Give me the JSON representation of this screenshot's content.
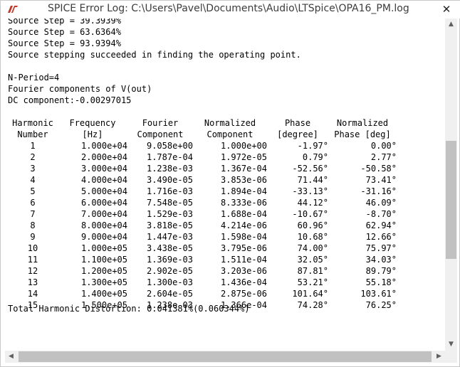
{
  "window": {
    "title": "SPICE Error Log: C:\\Users\\Pavel\\Documents\\Audio\\LTSpice\\OPA16_PM.log",
    "close_glyph": "✕"
  },
  "log_lines": [
    "Source Step = 39.3939%",
    "Source Step = 63.6364%",
    "Source Step = 93.9394%",
    "Source stepping succeeded in finding the operating point.",
    "",
    "N-Period=4",
    "Fourier components of V(out)",
    "DC component:-0.00297015"
  ],
  "table": {
    "header_row1": [
      "Harmonic",
      "Frequency",
      "Fourier",
      "Normalized",
      "Phase",
      "Normalized"
    ],
    "header_row2": [
      "Number",
      "[Hz]",
      "Component",
      "Component",
      "[degree]",
      "Phase [deg]"
    ],
    "rows": [
      [
        "1",
        "1.000e+04",
        "9.058e+00",
        "1.000e+00",
        "-1.97°",
        "0.00°"
      ],
      [
        "2",
        "2.000e+04",
        "1.787e-04",
        "1.972e-05",
        "0.79°",
        "2.77°"
      ],
      [
        "3",
        "3.000e+04",
        "1.238e-03",
        "1.367e-04",
        "-52.56°",
        "-50.58°"
      ],
      [
        "4",
        "4.000e+04",
        "3.490e-05",
        "3.853e-06",
        "71.44°",
        "73.41°"
      ],
      [
        "5",
        "5.000e+04",
        "1.716e-03",
        "1.894e-04",
        "-33.13°",
        "-31.16°"
      ],
      [
        "6",
        "6.000e+04",
        "7.548e-05",
        "8.333e-06",
        "44.12°",
        "46.09°"
      ],
      [
        "7",
        "7.000e+04",
        "1.529e-03",
        "1.688e-04",
        "-10.67°",
        "-8.70°"
      ],
      [
        "8",
        "8.000e+04",
        "3.818e-05",
        "4.214e-06",
        "60.96°",
        "62.94°"
      ],
      [
        "9",
        "9.000e+04",
        "1.447e-03",
        "1.598e-04",
        "10.68°",
        "12.66°"
      ],
      [
        "10",
        "1.000e+05",
        "3.438e-05",
        "3.795e-06",
        "74.00°",
        "75.97°"
      ],
      [
        "11",
        "1.100e+05",
        "1.369e-03",
        "1.511e-04",
        "32.05°",
        "34.03°"
      ],
      [
        "12",
        "1.200e+05",
        "2.902e-05",
        "3.203e-06",
        "87.81°",
        "89.79°"
      ],
      [
        "13",
        "1.300e+05",
        "1.300e-03",
        "1.436e-04",
        "53.21°",
        "55.18°"
      ],
      [
        "14",
        "1.400e+05",
        "2.604e-05",
        "2.875e-06",
        "101.64°",
        "103.61°"
      ],
      [
        "15",
        "1.500e+05",
        "1.238e-03",
        "1.366e-04",
        "74.28°",
        "76.25°"
      ]
    ]
  },
  "thd_line": "Total Harmonic Distortion: 0.041381%(0.060344%)",
  "scrollbars": {
    "up": "▲",
    "down": "▼",
    "left": "◀",
    "right": "▶"
  }
}
